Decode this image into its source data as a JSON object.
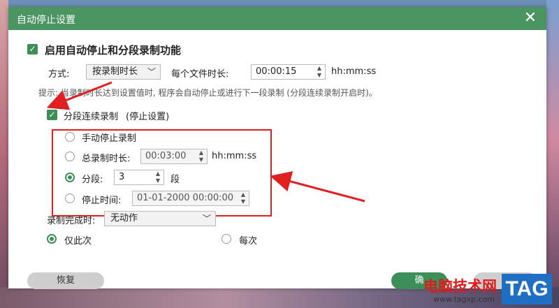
{
  "dialog": {
    "title": "自动停止设置"
  },
  "main": {
    "enable_label": "启用自动停止和分段录制功能",
    "method_label": "方式:",
    "method_value": "按录制时长",
    "per_file_label": "每个文件时长:",
    "per_file_value": "00:00:15",
    "time_format": "hh:mm:ss",
    "hint": "提示: 当录制时长达到设置值时, 程序会自动停止或进行下一段录制 (分段连续录制开启时)。",
    "segment_label": "分段连续录制",
    "stop_settings_label": "(停止设置)"
  },
  "options": {
    "manual_stop": "手动停止录制",
    "total_duration_label": "总录制时长:",
    "total_duration_value": "00:03:00",
    "total_duration_format": "hh:mm:ss",
    "segments_label": "分段:",
    "segments_value": "3",
    "segments_unit": "段",
    "stop_time_label": "停止时间:",
    "stop_time_value": "01-01-2000 00:00:00"
  },
  "completion": {
    "label": "录制完成时:",
    "action_value": "无动作",
    "once_label": "仅此次",
    "every_label": "每次"
  },
  "buttons": {
    "restore": "恢复",
    "ok": "确"
  },
  "watermark": {
    "text": "电脑技术网",
    "url": "www.tagxp.com",
    "tag": "TAG"
  },
  "colors": {
    "accent": "#3c8f57",
    "titlebar": "#4a9561",
    "annotation": "#e02020"
  }
}
